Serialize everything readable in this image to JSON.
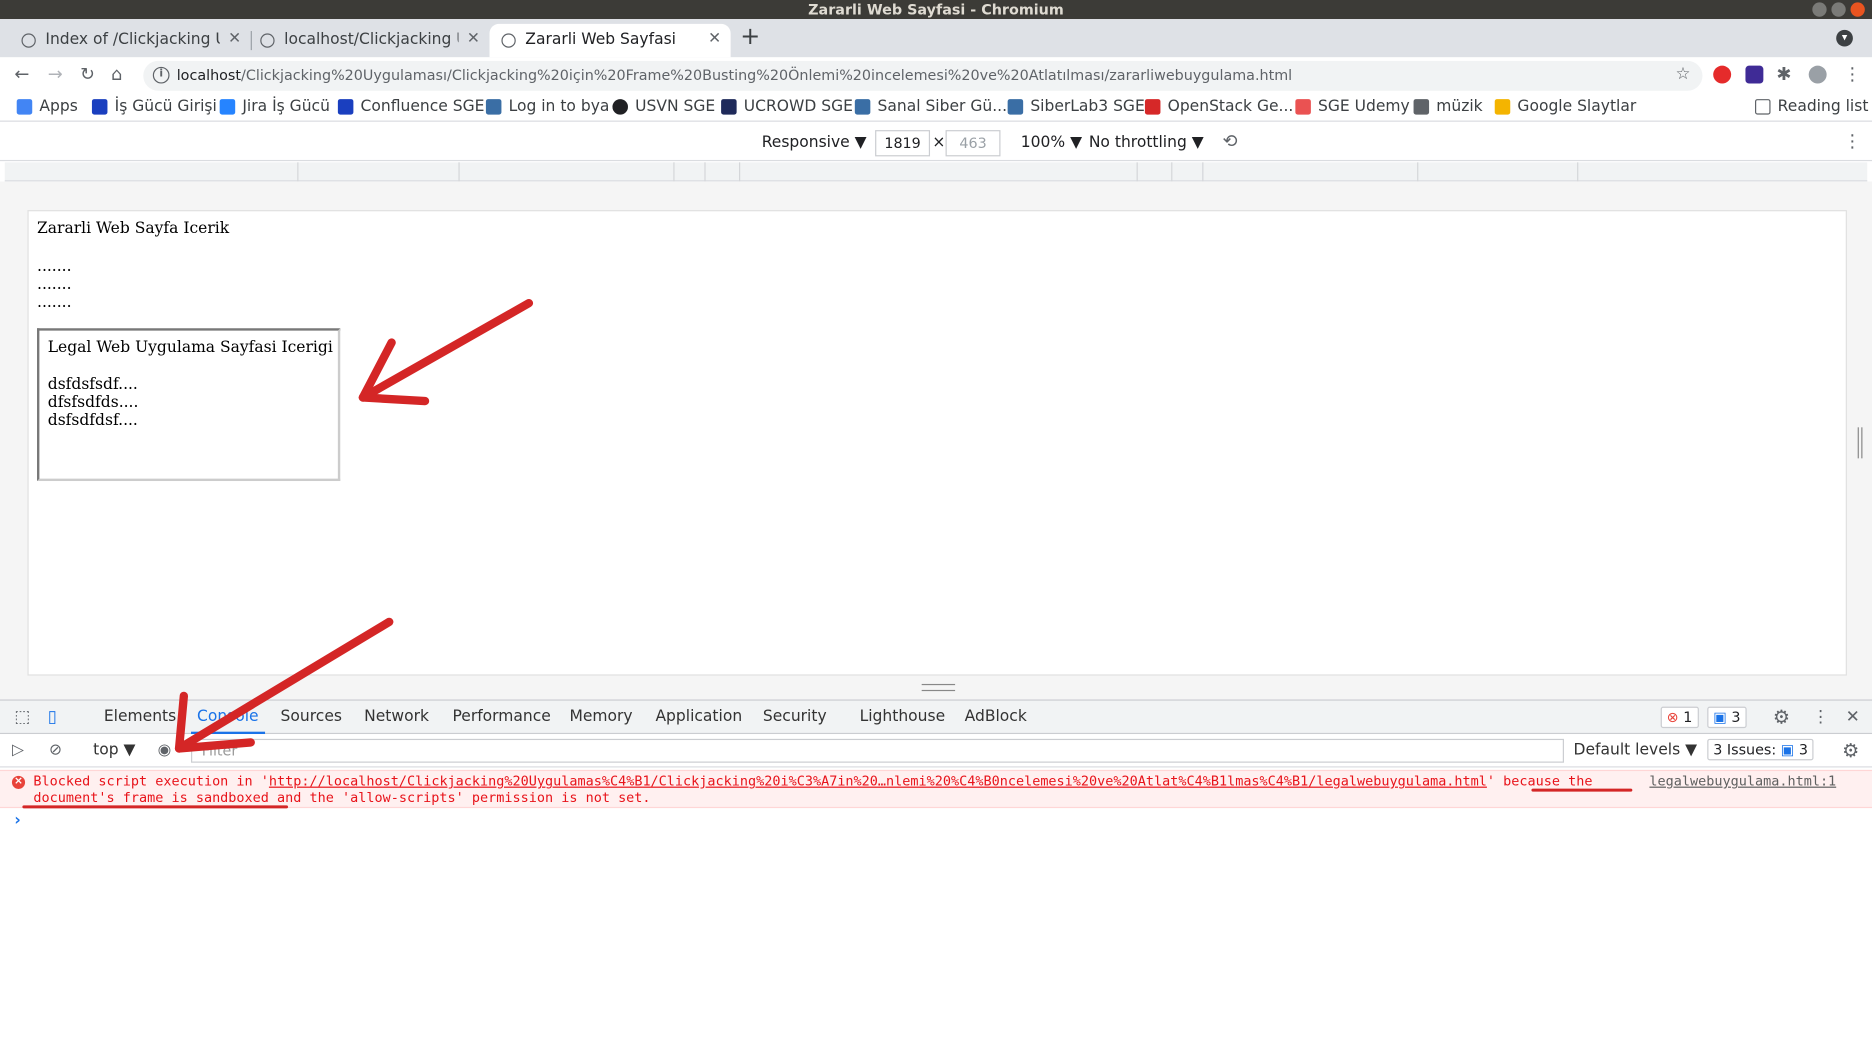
{
  "window": {
    "title": "Zararli Web Sayfasi - Chromium"
  },
  "tabs": [
    {
      "label": "Index of /Clickjacking Uyg",
      "close": "✕"
    },
    {
      "label": "localhost/Clickjacking Uyg",
      "close": "✕"
    },
    {
      "label": "Zararli Web Sayfasi",
      "close": "✕"
    }
  ],
  "new_tab": "+",
  "address": {
    "host": "localhost",
    "path": "/Clickjacking%20Uygulaması/Clickjacking%20için%20Frame%20Busting%20Önlemi%20incelemesi%20ve%20Atlatılması/zararliwebuygulama.html"
  },
  "bookmarks": [
    {
      "label": "Apps",
      "color": "#4285f4"
    },
    {
      "label": "İş Gücü Girişi",
      "color": "#1a3fbf"
    },
    {
      "label": "Jira İş Gücü",
      "color": "#2684ff"
    },
    {
      "label": "Confluence SGE",
      "color": "#1a3fbf"
    },
    {
      "label": "Log in to bya",
      "color": "#3a6ea5"
    },
    {
      "label": "USVN SGE",
      "color": "#202124"
    },
    {
      "label": "UCROWD SGE",
      "color": "#1f2a5a"
    },
    {
      "label": "Sanal Siber Gü...",
      "color": "#3a6ea5"
    },
    {
      "label": "SiberLab3 SGE",
      "color": "#3a6ea5"
    },
    {
      "label": "OpenStack Ge...",
      "color": "#d62828"
    },
    {
      "label": "SGE Udemy",
      "color": "#ea5252"
    },
    {
      "label": "müzik",
      "color": "#5f6368"
    },
    {
      "label": "Google Slaytlar",
      "color": "#f4b400"
    }
  ],
  "reading_list": "Reading list",
  "device_toolbar": {
    "mode": "Responsive ▼",
    "width": "1819",
    "times": "×",
    "height": "463",
    "zoom": "100% ▼",
    "throttling": "No throttling ▼"
  },
  "page": {
    "title": "Zararli Web Sayfa Icerik",
    "dots": [
      ".......",
      ".......",
      "......."
    ],
    "iframe": {
      "title": "Legal Web Uygulama Sayfasi Icerigi",
      "lines": [
        "dsfdsfsdf....",
        "dfsfsdfds....",
        "dsfsdfdsf...."
      ]
    }
  },
  "devtools": {
    "tabs": [
      "Elements",
      "Console",
      "Sources",
      "Network",
      "Performance",
      "Memory",
      "Application",
      "Security",
      "Lighthouse",
      "AdBlock"
    ],
    "error_count": "1",
    "message_count": "3",
    "console": {
      "context": "top ▼",
      "filter_placeholder": "Filter",
      "levels": "Default levels ▼",
      "issues_label": "3 Issues:",
      "issues_count": "3"
    },
    "error": {
      "prefix": "Blocked script execution in '",
      "url": "http://localhost/Clickjacking%20Uygulamas%C4%B1/Clickjacking%20i%C3%A7in%20…nlemi%20%C4%B0ncelemesi%20ve%20Atlat%C4%B1lmas%C4%B1/legalwebuygulama.html",
      "suffix": "' because the document's frame is sandboxed and the 'allow-scripts' permission is not set.",
      "source": "legalwebuygulama.html:1"
    },
    "prompt": "›"
  },
  "colors": {
    "accent": "#1a73e8",
    "error": "#e8131a",
    "annotation": "#d42626"
  }
}
